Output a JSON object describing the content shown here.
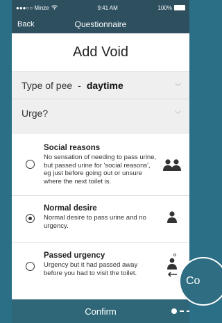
{
  "status": {
    "carrier": "●●●○○ Minze",
    "time": "9:41 AM",
    "battery": "100%"
  },
  "nav": {
    "back": "Back",
    "title": "Questionnaire"
  },
  "page": {
    "title": "Add Void"
  },
  "fields": {
    "type_label": "Type of pee",
    "type_sep": "-",
    "type_value": "daytime",
    "urge_label": "Urge?"
  },
  "options": [
    {
      "title": "Social reasons",
      "desc": "No sensation of needing to pass urine, but passed urine for 'social reasons', eg just before going out or unsure where the next toilet is.",
      "icon": "two-people-icon",
      "selected": false
    },
    {
      "title": "Normal desire",
      "desc": "Normal desire to pass urine and no urgency.",
      "icon": "person-icon",
      "selected": true
    },
    {
      "title": "Passed urgency",
      "desc": "Urgency but it had passed away before you had to visit the toilet.",
      "icon": "person-walking-away-icon",
      "selected": false
    }
  ],
  "footer": {
    "confirm": "Confirm"
  },
  "bubble": {
    "text": "Co"
  },
  "colors": {
    "header": "#2d4f5e",
    "footer": "#2f6778",
    "background": "#2b6f87"
  }
}
